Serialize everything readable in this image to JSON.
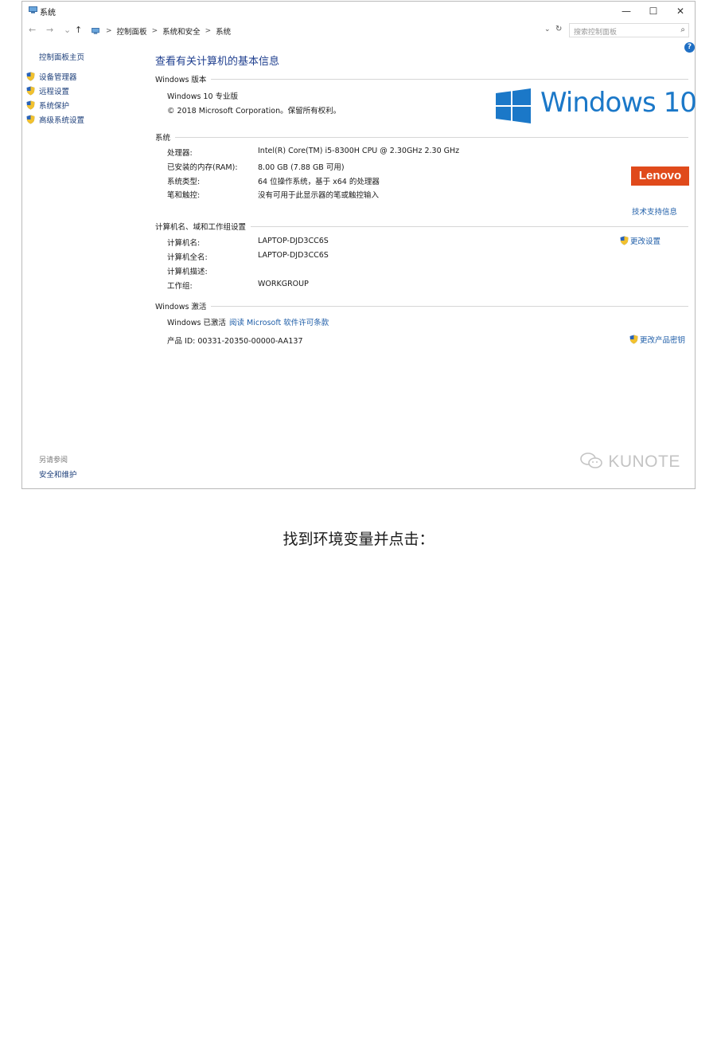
{
  "window": {
    "title": "系统",
    "controls": {
      "minimize": "—",
      "maximize": "☐",
      "close": "✕"
    }
  },
  "address_bar": {
    "nav": {
      "back": "←",
      "forward": "→",
      "recent": "⌄",
      "up": "↑"
    },
    "crumb_sep": ">",
    "breadcrumbs": [
      "控制面板",
      "系统和安全",
      "系统"
    ],
    "dropdown": "⌄",
    "refresh": "↻",
    "search_placeholder": "搜索控制面板",
    "search_icon": "⌕"
  },
  "help_label": "?",
  "sidebar": {
    "home": "控制面板主页",
    "items": [
      "设备管理器",
      "远程设置",
      "系统保护",
      "高级系统设置"
    ],
    "see_also_title": "另请参阅",
    "see_also_link": "安全和维护"
  },
  "main": {
    "title": "查看有关计算机的基本信息",
    "edition_section": {
      "title": "Windows 版本",
      "edition": "Windows 10 专业版",
      "copyright": "© 2018 Microsoft Corporation。保留所有权利。"
    },
    "windows_logo_text": "Windows 10",
    "system_section": {
      "title": "系统",
      "rows": [
        {
          "label": "处理器:",
          "value": "Intel(R) Core(TM) i5-8300H CPU @ 2.30GHz   2.30 GHz"
        },
        {
          "label": "已安装的内存(RAM):",
          "value": "8.00 GB (7.88 GB 可用)"
        },
        {
          "label": "系统类型:",
          "value": "64 位操作系统，基于 x64 的处理器"
        },
        {
          "label": "笔和触控:",
          "value": "没有可用于此显示器的笔或触控输入"
        }
      ],
      "oem_logo": "Lenovo",
      "support_link": "技术支持信息"
    },
    "computer_section": {
      "title": "计算机名、域和工作组设置",
      "rows": [
        {
          "label": "计算机名:",
          "value": "LAPTOP-DJD3CC6S"
        },
        {
          "label": "计算机全名:",
          "value": "LAPTOP-DJD3CC6S"
        },
        {
          "label": "计算机描述:",
          "value": ""
        },
        {
          "label": "工作组:",
          "value": "WORKGROUP"
        }
      ],
      "change_settings": "更改设置"
    },
    "activation_section": {
      "title": "Windows 激活",
      "status": "Windows 已激活",
      "license_link": "阅读 Microsoft 软件许可条款",
      "product_id": "产品 ID: 00331-20350-00000-AA137",
      "change_key": "更改产品密钥"
    }
  },
  "watermark": "KUNOTE",
  "caption": "找到环境变量并点击："
}
